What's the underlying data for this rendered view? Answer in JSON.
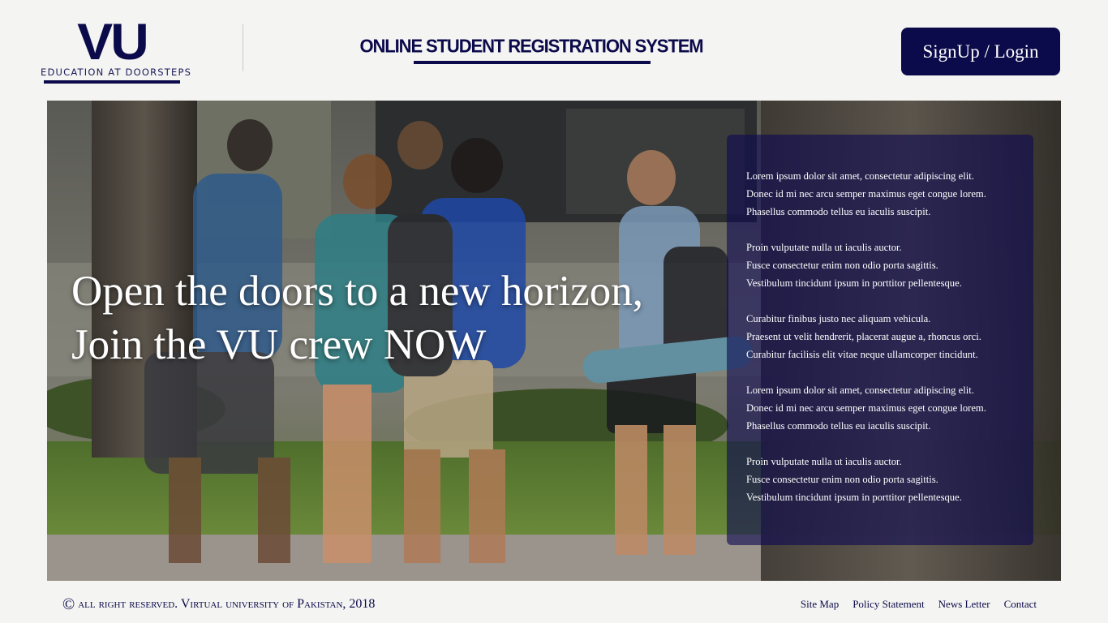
{
  "header": {
    "logo_mark": "VU",
    "logo_tagline": "EDUCATION AT DOORSTEPS",
    "site_title": "ONLINE STUDENT REGISTRATION SYSTEM",
    "auth_button": "SignUp / Login"
  },
  "hero": {
    "headline_line1": "Open the doors to a new horizon,",
    "headline_line2": "Join the VU crew NOW",
    "paragraphs": [
      [
        "Lorem ipsum dolor sit amet, consectetur adipiscing elit.",
        "Donec id mi nec arcu semper maximus eget congue lorem.",
        "Phasellus commodo tellus eu iaculis suscipit."
      ],
      [
        "Proin vulputate nulla ut iaculis auctor.",
        "Fusce consectetur enim non odio porta sagittis.",
        "Vestibulum tincidunt ipsum in porttitor pellentesque."
      ],
      [
        "Curabitur finibus justo nec aliquam vehicula.",
        "Praesent ut velit hendrerit, placerat augue a, rhoncus orci.",
        "Curabitur facilisis elit vitae neque ullamcorper tincidunt."
      ],
      [
        "Lorem ipsum dolor sit amet, consectetur adipiscing elit.",
        "Donec id mi nec arcu semper maximus eget congue lorem.",
        "Phasellus commodo tellus eu iaculis suscipit."
      ],
      [
        "Proin vulputate nulla ut iaculis auctor.",
        "Fusce consectetur enim non odio porta sagittis.",
        "Vestibulum tincidunt ipsum in porttitor pellentesque."
      ]
    ]
  },
  "footer": {
    "copyright_icon": "©",
    "copyright_text": "all right reserved. Virtual university of Pakistan, 2018",
    "links": [
      "Site Map",
      "Policy Statement",
      "News Letter",
      "Contact"
    ]
  },
  "colors": {
    "brand_navy": "#0b0a4a",
    "background": "#f4f4f2",
    "panel_overlay": "rgba(14,10,82,0.62)"
  },
  "icons": {
    "copyright": "copyright-icon"
  }
}
